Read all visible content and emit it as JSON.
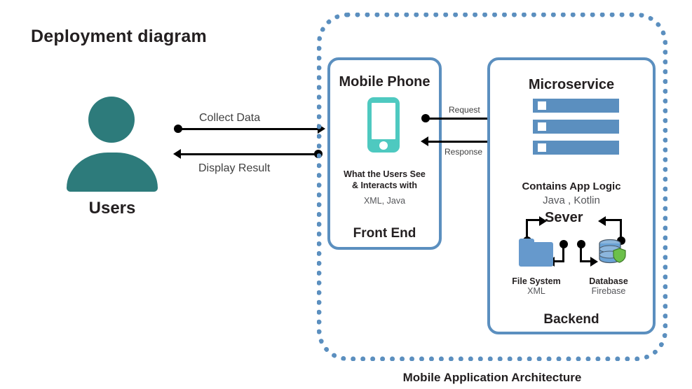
{
  "title": "Deployment diagram",
  "actor": {
    "label": "Users",
    "icon": "user-icon",
    "color": "#2d7b7b"
  },
  "edges": [
    {
      "id": "collect-data",
      "label": "Collect Data",
      "direction": "right"
    },
    {
      "id": "display-result",
      "label": "Display Result",
      "direction": "left"
    },
    {
      "id": "request",
      "label": "Request",
      "direction": "right"
    },
    {
      "id": "response",
      "label": "Response",
      "direction": "left"
    }
  ],
  "container": {
    "caption": "Mobile Application Architecture",
    "border_color": "#5b8fbf",
    "border_style": "dotted"
  },
  "frontend": {
    "title": "Mobile Phone",
    "icon": "mobile-phone-icon",
    "icon_color": "#4ec9c0",
    "description_line1": "What the Users See",
    "description_line2": "& Interacts with",
    "tech": "XML, Java",
    "footer": "Front End",
    "border_color": "#5b8fbf"
  },
  "backend": {
    "title": "Microservice",
    "icon": "server-rack-icon",
    "server_bar_color": "#5b8fbf",
    "server_bars": 3,
    "description": "Contains App Logic",
    "tech": "Java , Kotlin",
    "server_label": "Sever",
    "footer": "Backend",
    "border_color": "#5b8fbf",
    "assets": [
      {
        "id": "file-system",
        "name": "File System",
        "tech": "XML",
        "icon": "folder-icon",
        "icon_color": "#6699cc"
      },
      {
        "id": "database",
        "name": "Database",
        "tech": "Firebase",
        "icon": "database-icon",
        "icon_color": "#6699cc",
        "badge_color": "#6cc04a"
      }
    ]
  }
}
